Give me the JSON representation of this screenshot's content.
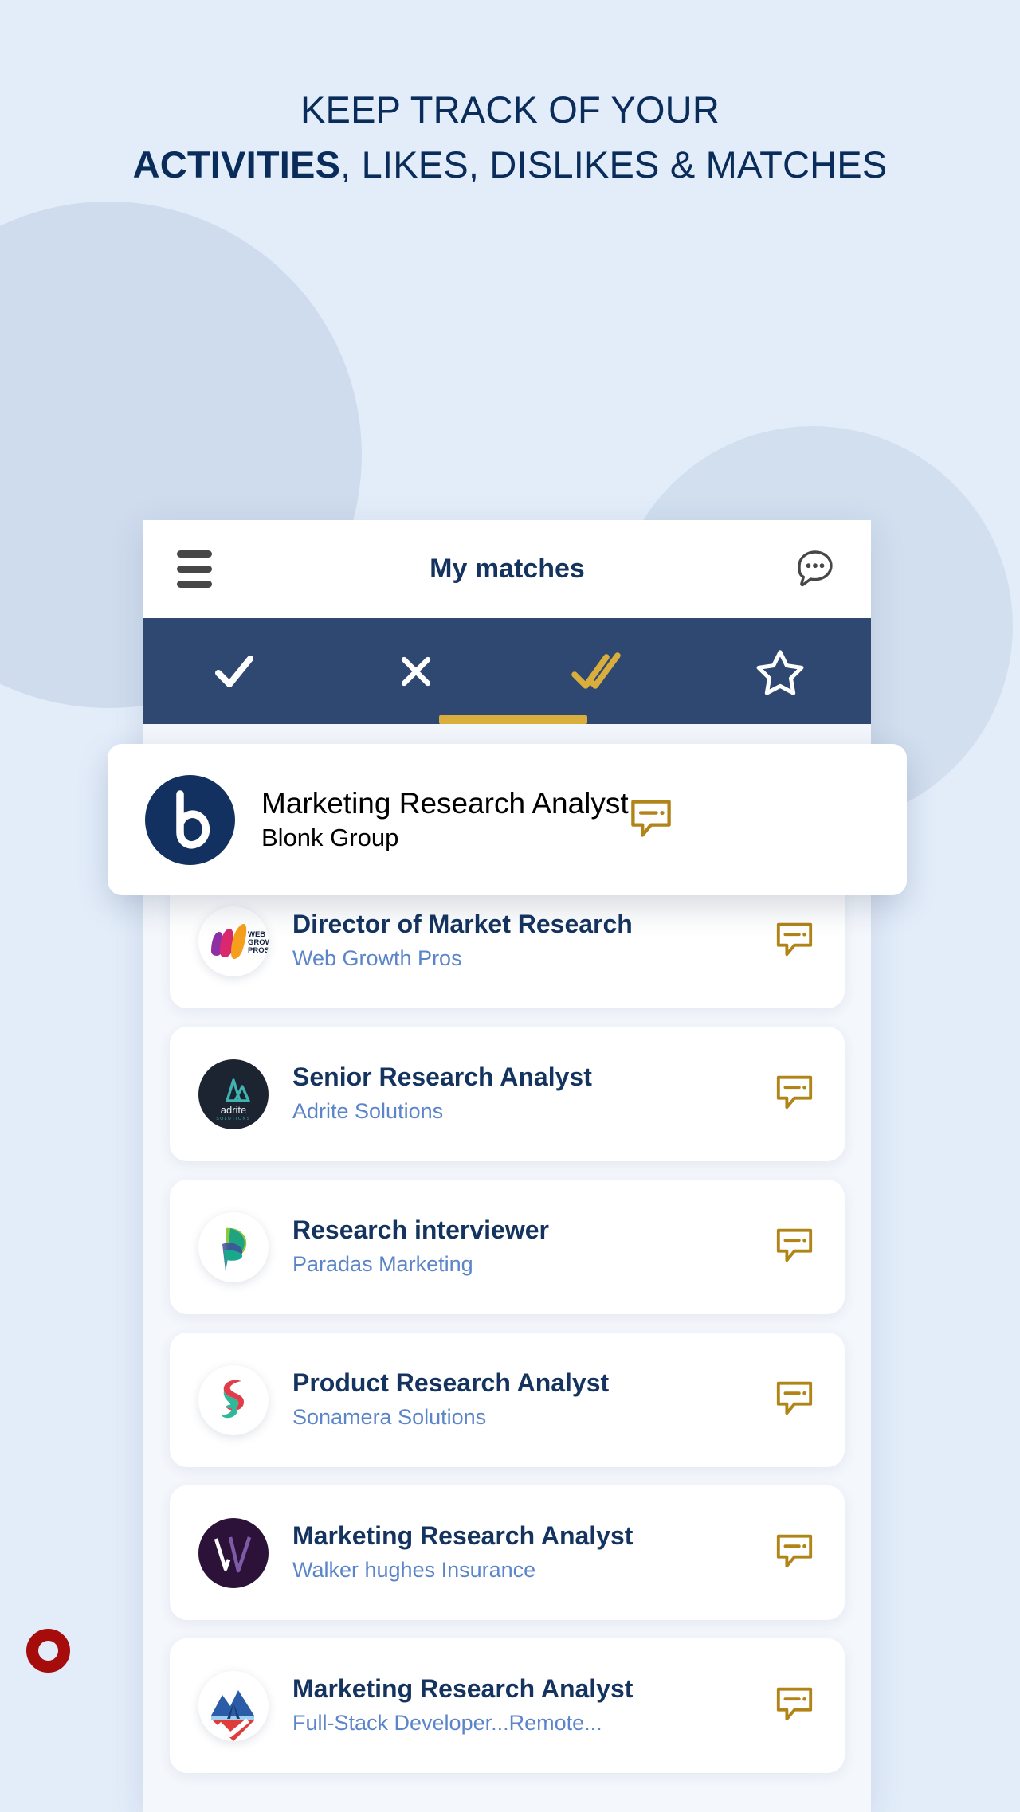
{
  "promo": {
    "headline_line1": "KEEP TRACK OF YOUR",
    "headline_bold": "ACTIVITIES",
    "headline_rest": ", LIKES, DISLIKES & MATCHES",
    "brand_mark": "red-ring-logo"
  },
  "colors": {
    "page_bg": "#e3edfa",
    "blob": "#c7d6e9",
    "navy_text": "#0a2c5a",
    "tabbar_navy": "#2e4872",
    "accent_gold": "#d9ae3d",
    "company_blue": "#5b84c9",
    "brand_red": "#a70c0c",
    "card_white": "#ffffff"
  },
  "app": {
    "title": "My matches",
    "menu_icon": "hamburger-icon",
    "chat_icon": "chat-bubble-dots-icon",
    "tabs": [
      {
        "id": "liked",
        "icon": "check-icon",
        "label": "Liked",
        "active": false
      },
      {
        "id": "disliked",
        "icon": "x-icon",
        "label": "Disliked",
        "active": false
      },
      {
        "id": "matches",
        "icon": "double-check-icon",
        "label": "Matches",
        "active": true
      },
      {
        "id": "starred",
        "icon": "star-outline-icon",
        "label": "Starred",
        "active": false
      }
    ],
    "comment_icon": "comment-bubble-icon",
    "featured": {
      "role": "Marketing Research Analyst",
      "company": "Blonk Group",
      "logo": "blonk-b-logo"
    },
    "matches": [
      {
        "role": "Director of Market Research",
        "company": "Web Growth Pros",
        "logo": "web-growth-pros-logo"
      },
      {
        "role": "Senior Research Analyst",
        "company": "Adrite Solutions",
        "logo": "adrite-solutions-logo"
      },
      {
        "role": "Research interviewer",
        "company": "Paradas Marketing",
        "logo": "paradas-marketing-logo"
      },
      {
        "role": "Product Research Analyst",
        "company": "Sonamera Solutions",
        "logo": "sonamera-solutions-logo"
      },
      {
        "role": "Marketing Research Analyst",
        "company": "Walker hughes Insurance",
        "logo": "walker-hughes-logo"
      },
      {
        "role": "Marketing Research Analyst",
        "company": "Full-Stack Developer...Remote...",
        "logo": "mountain-deer-logo"
      }
    ]
  }
}
